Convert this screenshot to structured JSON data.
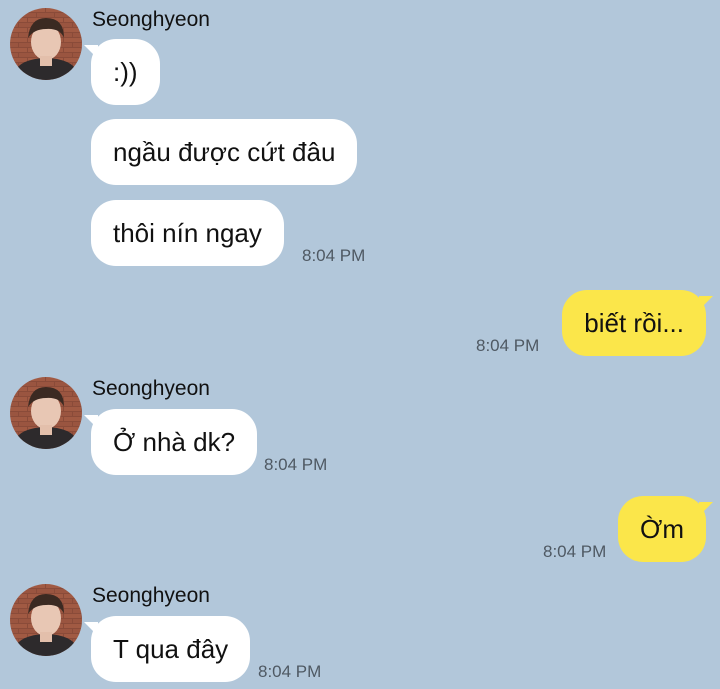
{
  "colors": {
    "background": "#b2c7da",
    "incoming_bubble": "#ffffff",
    "outgoing_bubble": "#fbe64a",
    "timestamp": "#4f5963"
  },
  "chat": {
    "messages": [
      {
        "sender": "Seonghyeon",
        "direction": "incoming",
        "text": ":))"
      },
      {
        "sender": "Seonghyeon",
        "direction": "incoming",
        "text": "ngầu được cứt đâu"
      },
      {
        "sender": "Seonghyeon",
        "direction": "incoming",
        "text": "thôi nín ngay",
        "time": "8:04 PM"
      },
      {
        "direction": "outgoing",
        "text": "biết rồi...",
        "time": "8:04 PM"
      },
      {
        "sender": "Seonghyeon",
        "direction": "incoming",
        "text": "Ở nhà dk?",
        "time": "8:04 PM"
      },
      {
        "direction": "outgoing",
        "text": "Ờm",
        "time": "8:04 PM"
      },
      {
        "sender": "Seonghyeon",
        "direction": "incoming",
        "text": "T qua đây",
        "time": "8:04 PM"
      }
    ],
    "avatar_icon": "profile-photo"
  }
}
